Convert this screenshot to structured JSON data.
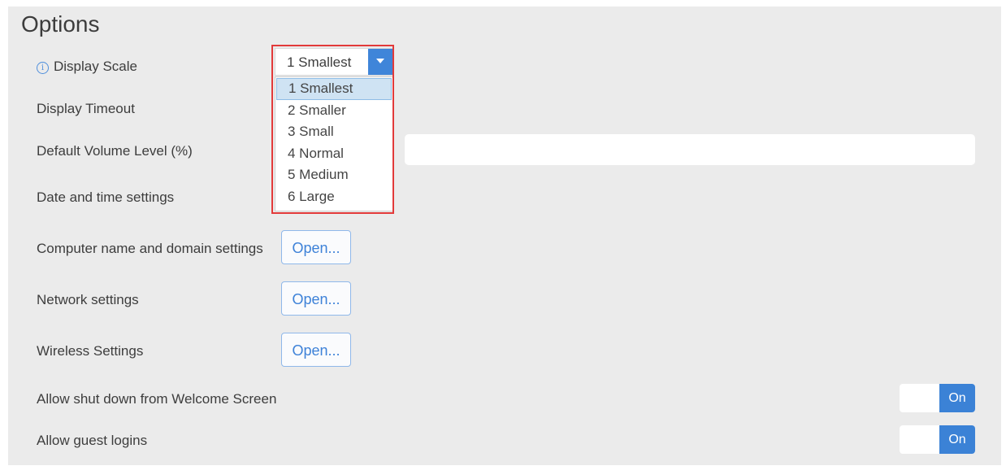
{
  "page": {
    "title": "Options"
  },
  "rows": {
    "display_scale": "Display Scale",
    "display_timeout": "Display Timeout",
    "default_volume": "Default Volume Level (%)",
    "date_time": "Date and time settings",
    "computer_name": "Computer name and domain settings",
    "network": "Network settings",
    "wireless": "Wireless Settings",
    "allow_shutdown": "Allow shut down from Welcome Screen",
    "allow_guest": "Allow guest logins"
  },
  "buttons": {
    "open_label": "Open..."
  },
  "toggles": {
    "on_label": "On"
  },
  "display_scale_select": {
    "selected": "1 Smallest",
    "options": [
      "1 Smallest",
      "2 Smaller",
      "3 Small",
      "4 Normal",
      "5 Medium",
      "6 Large"
    ],
    "highlighted_index": 0
  },
  "icons": {
    "info": "info-icon",
    "dropdown_arrow": "chevron-down-icon"
  },
  "colors": {
    "accent": "#3b82d6",
    "highlight_border": "#e23a3a",
    "background": "#ebebeb"
  }
}
